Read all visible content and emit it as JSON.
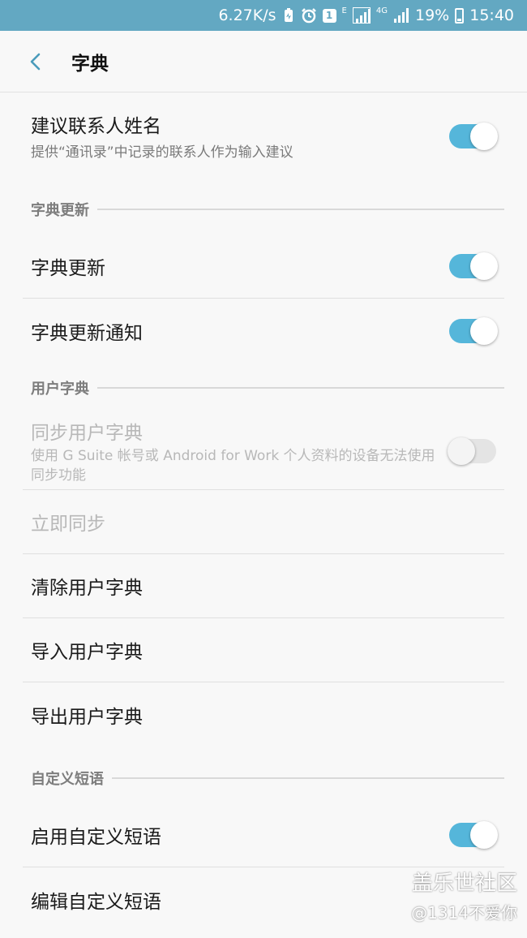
{
  "status_bar": {
    "speed": "6.27K/s",
    "notification_badge": "1",
    "network_e": "E",
    "network_4g": "4G",
    "battery": "19%",
    "time": "15:40",
    "color": "#63a8c2"
  },
  "header": {
    "title": "字典",
    "back_icon": "chevron-left-icon"
  },
  "suggest_contacts": {
    "title": "建议联系人姓名",
    "subtitle": "提供“通讯录”中记录的联系人作为输入建议",
    "enabled": true
  },
  "sections": {
    "dictionary_update": "字典更新",
    "user_dictionary": "用户字典",
    "custom_phrases": "自定义短语"
  },
  "dictionary_update": {
    "update_title": "字典更新",
    "update_enabled": true,
    "notify_title": "字典更新通知",
    "notify_enabled": true
  },
  "user_dictionary": {
    "sync_title": "同步用户字典",
    "sync_subtitle": "使用 G Suite 帐号或 Android for Work 个人资料的设备无法使用同步功能",
    "sync_enabled": false,
    "sync_now": "立即同步",
    "clear": "清除用户字典",
    "import": "导入用户字典",
    "export": "导出用户字典"
  },
  "custom_phrases": {
    "enable_title": "启用自定义短语",
    "enable_enabled": true,
    "edit_title": "编辑自定义短语"
  },
  "watermark": {
    "main": "盖乐世社区",
    "sub": "@1314不爱你"
  },
  "accent_color": "#55b6da"
}
